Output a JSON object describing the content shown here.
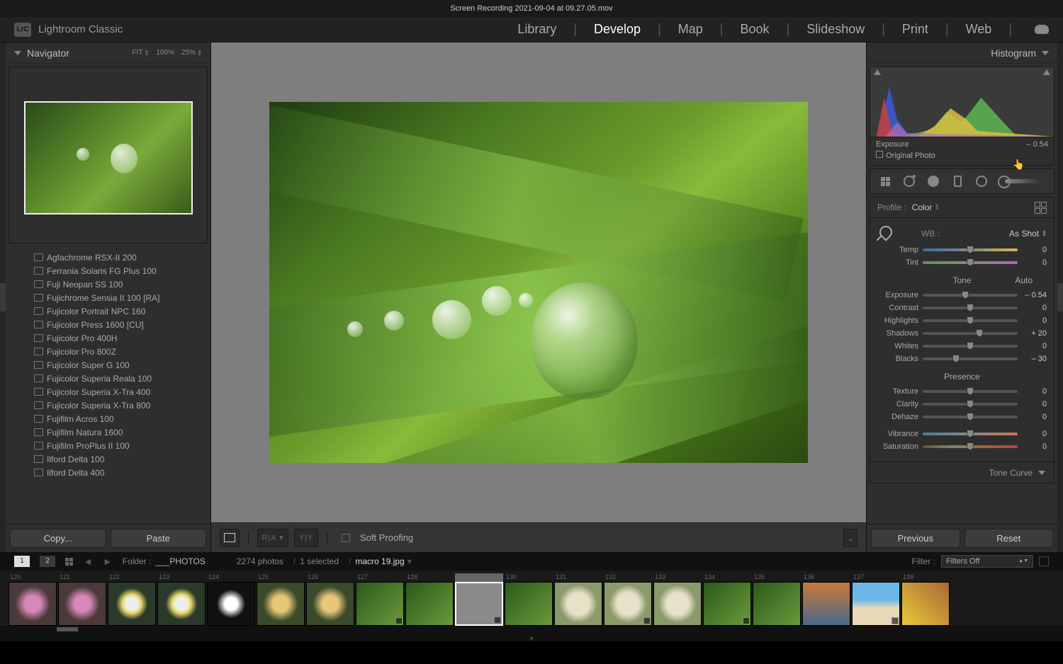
{
  "window_title": "Screen Recording 2021-09-04 at 09.27.05.mov",
  "app_name": "Lightroom Classic",
  "logo": "LrC",
  "modules": [
    "Library",
    "Develop",
    "Map",
    "Book",
    "Slideshow",
    "Print",
    "Web"
  ],
  "active_module": "Develop",
  "navigator": {
    "title": "Navigator",
    "zoom": [
      "FIT",
      "100%",
      "25%"
    ]
  },
  "presets": [
    "Agfachrome RSX-II 200",
    "Ferrania Solaris FG Plus 100",
    "Fuji Neopan SS 100",
    "Fujichrome Sensia II 100 [RA]",
    "Fujicolor Portrait NPC 160",
    "Fujicolor Press 1600 [CU]",
    "Fujicolor Pro 400H",
    "Fujicolor Pro 800Z",
    "Fujicolor Super G 100",
    "Fujicolor Superia Reala 100",
    "Fujicolor Superia X-Tra 400",
    "Fujicolor Superia X-Tra 800",
    "Fujifilm Acros 100",
    "Fujifilm Natura 1600",
    "Fujifilm ProPlus II 100",
    "Ilford Delta 100",
    "Ilford Delta 400"
  ],
  "left_buttons": {
    "copy": "Copy...",
    "paste": "Paste"
  },
  "center_toolbar": {
    "soft_proof": "Soft Proofing"
  },
  "right": {
    "histogram_title": "Histogram",
    "histogram_stat_label": "Exposure",
    "histogram_stat_value": "– 0.54",
    "original_photo": "Original Photo",
    "profile_label": "Profile :",
    "profile_value": "Color",
    "wb_label": "WB :",
    "wb_value": "As Shot",
    "tone_label": "Tone",
    "auto_label": "Auto",
    "presence_label": "Presence",
    "tone_curve_title": "Tone Curve",
    "sliders": {
      "temp": {
        "label": "Temp",
        "value": "0",
        "pos": 50
      },
      "tint": {
        "label": "Tint",
        "value": "0",
        "pos": 50
      },
      "exposure": {
        "label": "Exposure",
        "value": "– 0.54",
        "pos": 45
      },
      "contrast": {
        "label": "Contrast",
        "value": "0",
        "pos": 50
      },
      "highlights": {
        "label": "Highlights",
        "value": "0",
        "pos": 50
      },
      "shadows": {
        "label": "Shadows",
        "value": "+ 20",
        "pos": 60
      },
      "whites": {
        "label": "Whites",
        "value": "0",
        "pos": 50
      },
      "blacks": {
        "label": "Blacks",
        "value": "– 30",
        "pos": 35
      },
      "texture": {
        "label": "Texture",
        "value": "0",
        "pos": 50
      },
      "clarity": {
        "label": "Clarity",
        "value": "0",
        "pos": 50
      },
      "dehaze": {
        "label": "Dehaze",
        "value": "0",
        "pos": 50
      },
      "vibrance": {
        "label": "Vibrance",
        "value": "0",
        "pos": 50
      },
      "saturation": {
        "label": "Saturation",
        "value": "0",
        "pos": 50
      }
    },
    "buttons": {
      "previous": "Previous",
      "reset": "Reset"
    }
  },
  "info_bar": {
    "pages": [
      "1",
      "2"
    ],
    "active_page": "1",
    "folder_label": "Folder :",
    "folder_value": "___PHOTOS",
    "count": "2274 photos",
    "selection": "1 selected",
    "filename": "macro 19.jpg",
    "filter_label": "Filter :",
    "filter_value": "Filters Off"
  },
  "filmstrip": [
    {
      "num": "120",
      "cls": "ft-flower-p"
    },
    {
      "num": "121",
      "cls": "ft-flower-p"
    },
    {
      "num": "122",
      "cls": "ft-daisy"
    },
    {
      "num": "123",
      "cls": "ft-daisy"
    },
    {
      "num": "124",
      "cls": "ft-dark-daisy"
    },
    {
      "num": "125",
      "cls": "ft-flower"
    },
    {
      "num": "126",
      "cls": "ft-flower"
    },
    {
      "num": "127",
      "cls": "ft-green",
      "badge": true
    },
    {
      "num": "128",
      "cls": "ft-green"
    },
    {
      "num": "129",
      "cls": "ft-green",
      "badge": true,
      "selected": true
    },
    {
      "num": "130",
      "cls": "ft-green"
    },
    {
      "num": "131",
      "cls": "ft-dandy"
    },
    {
      "num": "132",
      "cls": "ft-dandy",
      "badge": true
    },
    {
      "num": "133",
      "cls": "ft-dandy"
    },
    {
      "num": "134",
      "cls": "ft-green",
      "badge": true
    },
    {
      "num": "135",
      "cls": "ft-green"
    },
    {
      "num": "136",
      "cls": "ft-autumn"
    },
    {
      "num": "137",
      "cls": "ft-beach",
      "badge": true
    },
    {
      "num": "138",
      "cls": "ft-yellow"
    }
  ]
}
